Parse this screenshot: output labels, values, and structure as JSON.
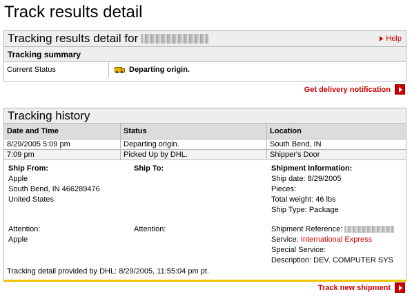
{
  "page_title": "Track results detail",
  "results_box": {
    "title": "Tracking results detail for",
    "help_label": "Help",
    "summary_heading": "Tracking summary",
    "status_label": "Current Status",
    "status_value": "Departing origin.",
    "status_icon": "truck-icon"
  },
  "delivery_notification_label": "Get delivery notification",
  "history": {
    "title": "Tracking history",
    "columns": [
      "Date and Time",
      "Status",
      "Location"
    ],
    "rows": [
      {
        "datetime": "8/29/2005 5:09 pm",
        "status": "Departing origin.",
        "location": "South Bend, IN"
      },
      {
        "datetime": "7:09 pm",
        "status": "Picked Up by DHL.",
        "location": "Shipper's Door"
      }
    ]
  },
  "details": {
    "ship_from_heading": "Ship From:",
    "ship_from_lines": [
      "Apple",
      "South Bend, IN  466289476",
      "United States"
    ],
    "ship_to_heading": "Ship To:",
    "shipment_info_heading": "Shipment Information:",
    "ship_date": "Ship date: 8/29/2005",
    "pieces": "Pieces:",
    "total_weight": "Total weight: 46 lbs",
    "ship_type": "Ship Type: Package",
    "attention_from_label": "Attention:",
    "attention_from_value": "Apple",
    "attention_to_label": "Attention:",
    "shipment_reference_label": "Shipment Reference:",
    "service_label": "Service:",
    "service_value": "International Express",
    "special_service": "Special Service:",
    "description": "Description: DEV. COMPUTER SYS",
    "provided_by": "Tracking detail provided by DHL: 8/29/2005, 11:55:04 pm pt."
  },
  "track_new_label": "Track new shipment",
  "colors": {
    "accent": "#cc0000",
    "header_bg": "#eeeeee",
    "table_header_bg": "#dcdcdc",
    "gold_rule": "#f0c400"
  }
}
